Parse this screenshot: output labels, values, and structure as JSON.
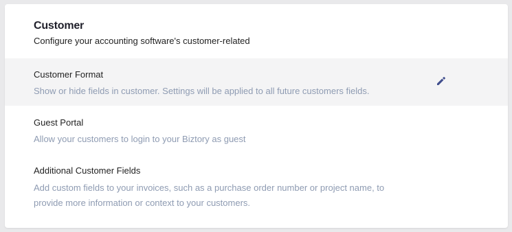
{
  "section": {
    "title": "Customer",
    "subtitle": "Configure your accounting software's customer-related"
  },
  "settings": [
    {
      "title": "Customer Format",
      "description": "Show or hide fields in customer. Settings will be applied to all future customers fields.",
      "icon": "pencil-icon"
    },
    {
      "title": "Guest Portal",
      "description": "Allow your customers to login to your Biztory as guest"
    },
    {
      "title": "Additional Customer Fields",
      "description": "Add custom fields to your invoices, such as a purchase order number or project name, to provide more information or context to your customers."
    }
  ],
  "colors": {
    "icon": "#3f4d8c",
    "description": "#8e9bb2",
    "highlight_row": "#f4f4f5"
  }
}
